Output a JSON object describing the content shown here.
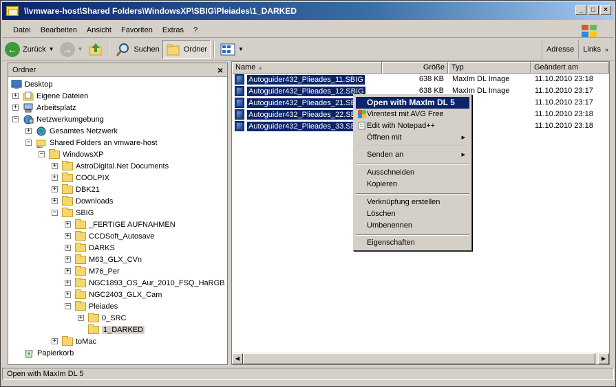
{
  "window": {
    "title": "\\\\vmware-host\\Shared Folders\\WindowsXP\\SBIG\\Pleiades\\1_DARKED"
  },
  "menubar": [
    "Datei",
    "Bearbeiten",
    "Ansicht",
    "Favoriten",
    "Extras",
    "?"
  ],
  "toolbar": {
    "back": "Zurück",
    "search": "Suchen",
    "folders": "Ordner",
    "address": "Adresse",
    "links": "Links"
  },
  "folderpane": {
    "header": "Ordner",
    "close": "×",
    "tree": [
      {
        "label": "Desktop"
      },
      {
        "label": "Eigene Dateien",
        "pm": "+"
      },
      {
        "label": "Arbeitsplatz",
        "pm": "+"
      },
      {
        "label": "Netzwerkumgebung",
        "pm": "−"
      },
      {
        "label": "Gesamtes Netzwerk",
        "pm": "+"
      },
      {
        "label": "Shared Folders an vmware-host",
        "pm": "−"
      },
      {
        "label": "WindowsXP",
        "pm": "−"
      },
      {
        "label": "AstroDigital.Net Documents",
        "pm": "+"
      },
      {
        "label": "COOLPIX",
        "pm": "+"
      },
      {
        "label": "DBK21",
        "pm": "+"
      },
      {
        "label": "Downloads",
        "pm": "+"
      },
      {
        "label": "SBIG",
        "pm": "−"
      },
      {
        "label": "_FERTIGE AUFNAHMEN",
        "pm": "+"
      },
      {
        "label": "CCDSoft_Autosave",
        "pm": "+"
      },
      {
        "label": "DARKS",
        "pm": "+"
      },
      {
        "label": "M63_GLX_CVn",
        "pm": "+"
      },
      {
        "label": "M76_Per",
        "pm": "+"
      },
      {
        "label": "NGC1893_OS_Aur_2010_FSQ_HaRGB",
        "pm": "+"
      },
      {
        "label": "NGC2403_GLX_Cam",
        "pm": "+"
      },
      {
        "label": "Pleiades",
        "pm": "−"
      },
      {
        "label": "0_SRC",
        "pm": "+"
      },
      {
        "label": "1_DARKED",
        "pm": ""
      },
      {
        "label": "toMac",
        "pm": "+"
      },
      {
        "label": "Papierkorb"
      }
    ]
  },
  "filelist": {
    "columns": {
      "name": "Name",
      "size": "Größe",
      "type": "Typ",
      "date": "Geändert am"
    },
    "rows": [
      {
        "name": "Autoguider432_Plieades_11.SBIG",
        "size": "638 KB",
        "type": "MaxIm DL Image",
        "date": "11.10.2010 23:18"
      },
      {
        "name": "Autoguider432_Plieades_12.SBIG",
        "size": "638 KB",
        "type": "MaxIm DL Image",
        "date": "11.10.2010 23:17"
      },
      {
        "name": "Autoguider432_Plieades_21.SBIG",
        "size": "",
        "type": "",
        "date": "11.10.2010 23:17"
      },
      {
        "name": "Autoguider432_Plieades_22.SBIG",
        "size": "",
        "type": "",
        "date": "11.10.2010 23:18"
      },
      {
        "name": "Autoguider432_Plieades_33.SBIG",
        "size": "",
        "type": "",
        "date": "11.10.2010 23:18"
      }
    ]
  },
  "context_menu": {
    "open": "Open with MaxIm DL 5",
    "virus": "Virentest mit AVG Free",
    "notepad": "Edit with Notepad++",
    "openwith": "Öffnen mit",
    "sendto": "Senden an",
    "cut": "Ausschneiden",
    "copy": "Kopieren",
    "shortcut": "Verknüpfung erstellen",
    "delete": "Löschen",
    "rename": "Umbenennen",
    "props": "Eigenschaften"
  },
  "statusbar": {
    "text": "Open with MaxIm DL 5"
  }
}
